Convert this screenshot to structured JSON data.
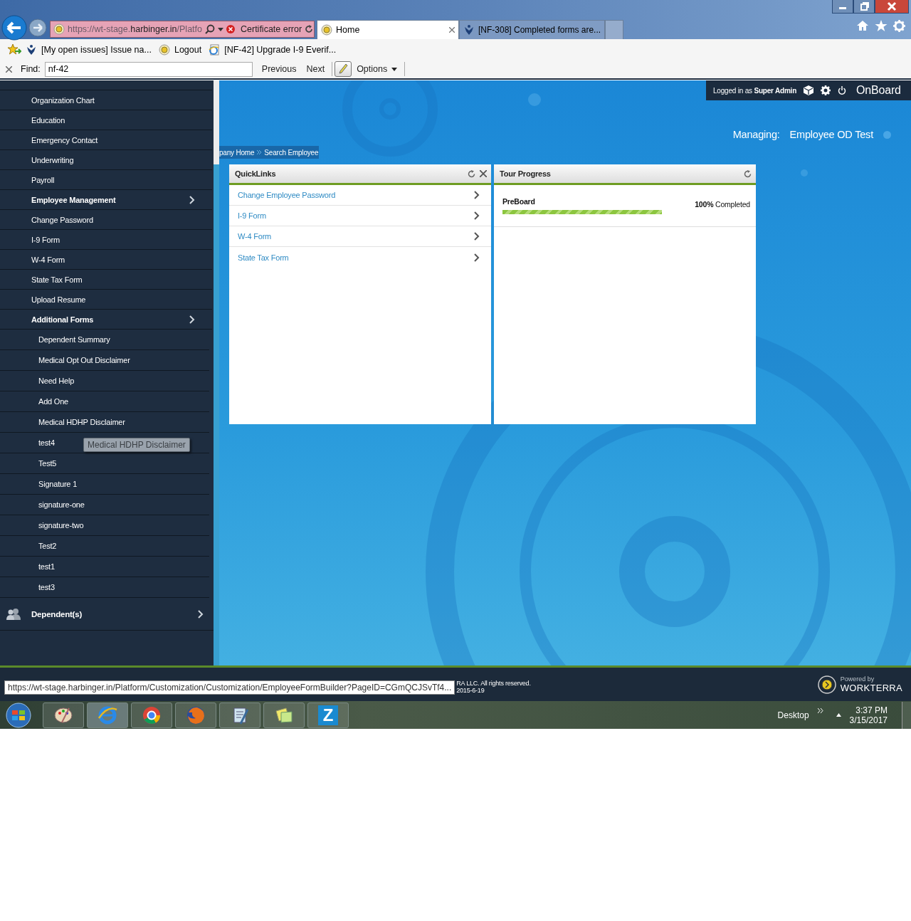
{
  "browser": {
    "address": {
      "prefix": "https://wt-stage.",
      "domain": "harbinger.in",
      "suffix": "/Platfo"
    },
    "certificate_error": "Certificate error",
    "tabs": [
      {
        "label": "Home",
        "selected": true
      },
      {
        "label": "[NF-308] Completed forms are...",
        "selected": false
      }
    ],
    "favorites": [
      {
        "label": "[My open issues] Issue na..."
      },
      {
        "label": "Logout"
      },
      {
        "label": "[NF-42] Upgrade I-9 Everif..."
      }
    ],
    "find": {
      "label": "Find:",
      "value": "nf-42",
      "buttons": [
        "Previous",
        "Next"
      ],
      "options": "Options"
    }
  },
  "header": {
    "logged_in_prefix": "Logged in as",
    "user": "Super Admin",
    "brand": "OnBoard",
    "managing_label": "Managing:",
    "managing_value": "Employee OD Test"
  },
  "breadcrumb": [
    "pany Home",
    "Search Employee"
  ],
  "sidebar": {
    "items": [
      {
        "label": "Organization Chart",
        "kind": "link"
      },
      {
        "label": "Education",
        "kind": "link"
      },
      {
        "label": "Emergency Contact",
        "kind": "link"
      },
      {
        "label": "Underwriting",
        "kind": "link"
      },
      {
        "label": "Payroll",
        "kind": "link"
      },
      {
        "label": "Employee Management",
        "kind": "section"
      },
      {
        "label": "Change Password",
        "kind": "link"
      },
      {
        "label": "I-9 Form",
        "kind": "link"
      },
      {
        "label": "W-4 Form",
        "kind": "link"
      },
      {
        "label": "State Tax Form",
        "kind": "link"
      },
      {
        "label": "Upload Resume",
        "kind": "link"
      },
      {
        "label": "Additional Forms",
        "kind": "section",
        "children": [
          {
            "label": "Dependent Summary"
          },
          {
            "label": "Medical Opt Out Disclaimer"
          },
          {
            "label": "Need Help"
          },
          {
            "label": "Add One"
          },
          {
            "label": "Medical HDHP Disclaimer"
          },
          {
            "label": "test4"
          },
          {
            "label": "Test5"
          },
          {
            "label": "Signature 1"
          },
          {
            "label": "signature-one"
          },
          {
            "label": "signature-two"
          },
          {
            "label": "Test2"
          },
          {
            "label": "test1"
          },
          {
            "label": "test3"
          }
        ]
      },
      {
        "label": "Dependent(s)",
        "kind": "group"
      }
    ],
    "tooltip": "Medical HDHP Disclaimer"
  },
  "quicklinks": {
    "title": "QuickLinks",
    "links": [
      "Change Employee Password",
      "I-9 Form",
      "W-4 Form",
      "State Tax Form"
    ]
  },
  "tour": {
    "title": "Tour Progress",
    "items": [
      {
        "name": "PreBoard",
        "level": 1.0,
        "status": "**100%** Completed"
      }
    ]
  },
  "footer": {
    "status_url": "https://wt-stage.harbinger.in/Platform/Customization/Customization/EmployeeFormBuilder?PageID=CGmQCJSvTf4...",
    "copyright": "RA LLC. All rights reserved.",
    "date": "2015-6-19",
    "powered_by": "Powered by",
    "brand": "WORKTERRA"
  },
  "taskbar": {
    "app_letter": "Z",
    "desktop": "Desktop",
    "time": "3:37 PM",
    "date": "3/15/2017"
  }
}
